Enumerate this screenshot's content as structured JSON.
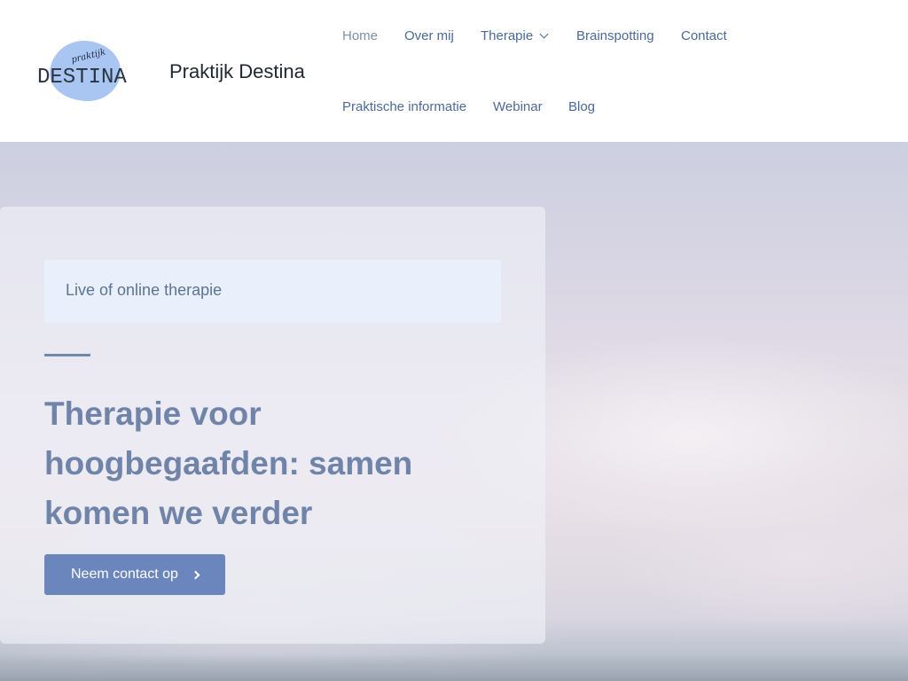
{
  "header": {
    "logo": {
      "small_text": "praktijk",
      "big_text": "DESTINA"
    },
    "site_title": "Praktijk Destina",
    "nav": [
      {
        "label": "Home",
        "active": true
      },
      {
        "label": "Over mij"
      },
      {
        "label": "Therapie",
        "has_dropdown": true,
        "dropdown_icon": "chevron-down-icon"
      },
      {
        "label": "Brainspotting"
      },
      {
        "label": "Contact"
      },
      {
        "label": "Praktische informatie"
      },
      {
        "label": "Webinar"
      },
      {
        "label": "Blog"
      }
    ]
  },
  "hero": {
    "tagline": "Live of online therapie",
    "heading": "Therapie voor hoogbegaafden: samen komen we verder",
    "cta_label": "Neem contact op",
    "cta_icon": "chevron-right-icon"
  },
  "colors": {
    "nav_link": "#4b6a9a",
    "nav_active": "#7d8fae",
    "heading": "#6f84a8",
    "button": "#6a86bd",
    "tagline_bg": "#e9f0fc",
    "logo_blob": "#a9c6f3"
  }
}
